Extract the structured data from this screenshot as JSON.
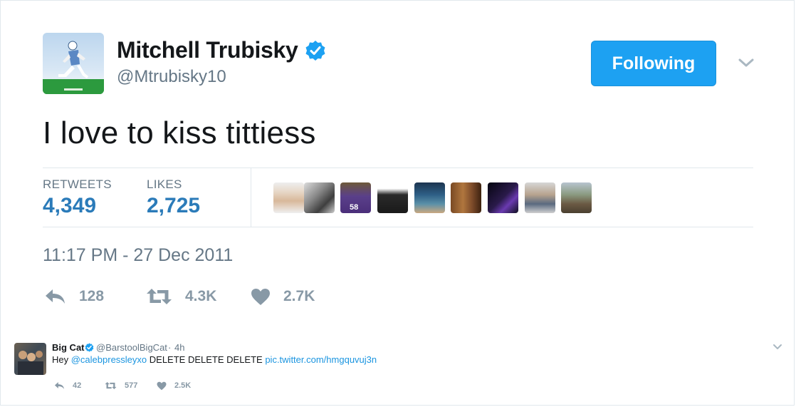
{
  "tweet": {
    "author_name": "Mitchell Trubisky",
    "handle": "@Mtrubisky10",
    "follow_label": "Following",
    "text": "I love to kiss tittiess",
    "stats": {
      "retweets_label": "RETWEETS",
      "retweets_value": "4,349",
      "likes_label": "LIKES",
      "likes_value": "2,725"
    },
    "timestamp": "11:17 PM - 27 Dec 2011",
    "actions": {
      "reply_count": "128",
      "retweet_count": "4.3K",
      "like_count": "2.7K"
    },
    "icons": [
      "verified-icon",
      "chevron-down-icon",
      "reply-icon",
      "retweet-icon",
      "heart-icon"
    ]
  },
  "reply": {
    "author_name": "Big Cat",
    "handle": "@BarstoolBigCat",
    "separator": "·",
    "time": "4h",
    "text_prefix": "Hey ",
    "mention": "@calebpressleyxo",
    "text_middle": " DELETE DELETE DELETE ",
    "link": "pic.twitter.com/hmgquvuj3n",
    "actions": {
      "reply_count": "42",
      "retweet_count": "577",
      "like_count": "2.5K"
    }
  },
  "colors": {
    "accent": "#1da1f2",
    "link": "#2b7bb9",
    "muted": "#657786",
    "icon_gray": "#8899a6"
  }
}
